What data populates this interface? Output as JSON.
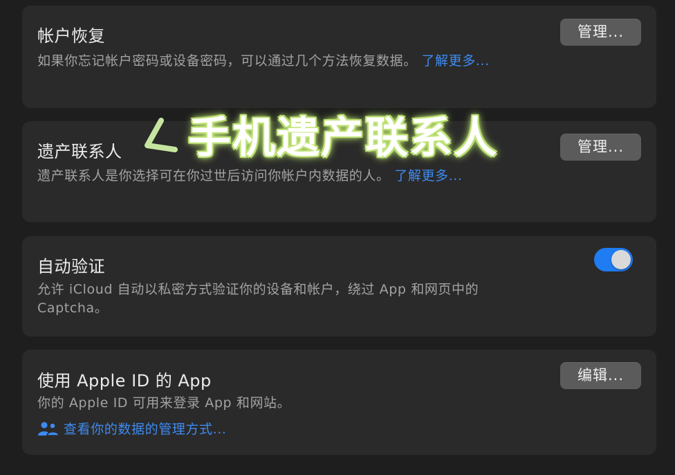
{
  "sections": [
    {
      "title": "帐户恢复",
      "description": "如果你忘记帐户密码或设备密码，可以通过几个方法恢复数据。",
      "link": "了解更多...",
      "button": "管理..."
    },
    {
      "title": "遗产联系人",
      "description": "遗产联系人是你选择可在你过世后访问你帐户内数据的人。",
      "link": "了解更多...",
      "button": "管理..."
    },
    {
      "title": "自动验证",
      "description": "允许 iCloud 自动以私密方式验证你的设备和帐户，绕过 App 和网页中的 Captcha。",
      "toggle_on": true
    },
    {
      "title": "使用 Apple ID 的 App",
      "description": "你的 Apple ID 可用来登录 App 和网站。",
      "link": "查看你的数据的管理方式...",
      "button": "编辑..."
    }
  ],
  "overlay": {
    "text": "手机遗产联系人",
    "glow_color": "#b8de6e"
  },
  "colors": {
    "link": "#3d8bf2",
    "toggle": "#1f7cf2",
    "card": "#2a2a2a",
    "background": "#1e1e1e"
  },
  "icons": {
    "people": "people-icon",
    "arrow": "arrow-mark"
  }
}
